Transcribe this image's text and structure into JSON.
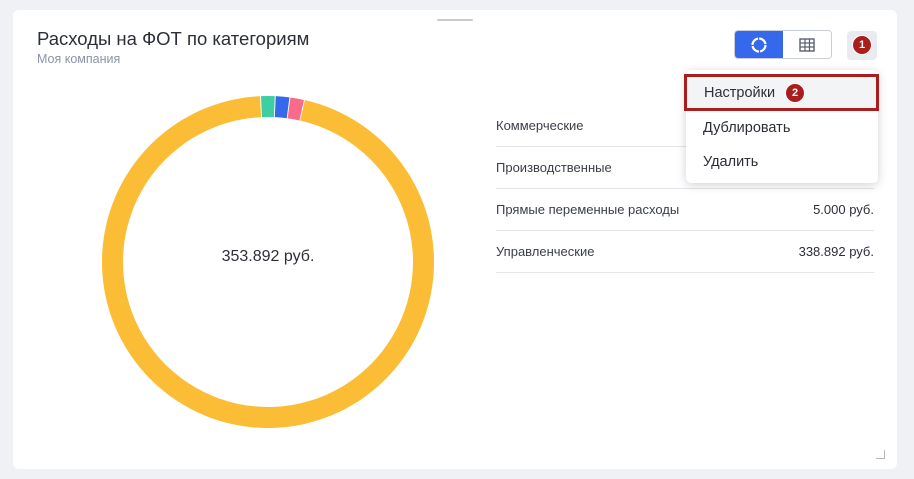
{
  "widget": {
    "title": "Расходы на ФОТ по категориям",
    "subtitle": "Моя компания",
    "total": "353.892 руб.",
    "callout_menu": "1",
    "callout_settings": "2"
  },
  "menu": {
    "items": [
      {
        "label": "Настройки"
      },
      {
        "label": "Дублировать"
      },
      {
        "label": "Удалить"
      }
    ]
  },
  "icons": {
    "donut_view": "donut-chart-icon",
    "table_view": "table-grid-icon"
  },
  "colors": {
    "accent": "#3568ea",
    "callout": "#a91d1d"
  },
  "chart_data": {
    "type": "pie",
    "categories": [
      "Коммерческие",
      "Производственные",
      "Прямые переменные расходы",
      "Управленческие"
    ],
    "values": [
      5000,
      5000,
      5000,
      338892
    ],
    "value_labels": [
      "",
      "",
      "5.000 руб.",
      "338.892 руб."
    ],
    "colors": [
      "#3dcfa2",
      "#3568ea",
      "#f96b8b",
      "#fbbd35"
    ],
    "donut": true
  }
}
